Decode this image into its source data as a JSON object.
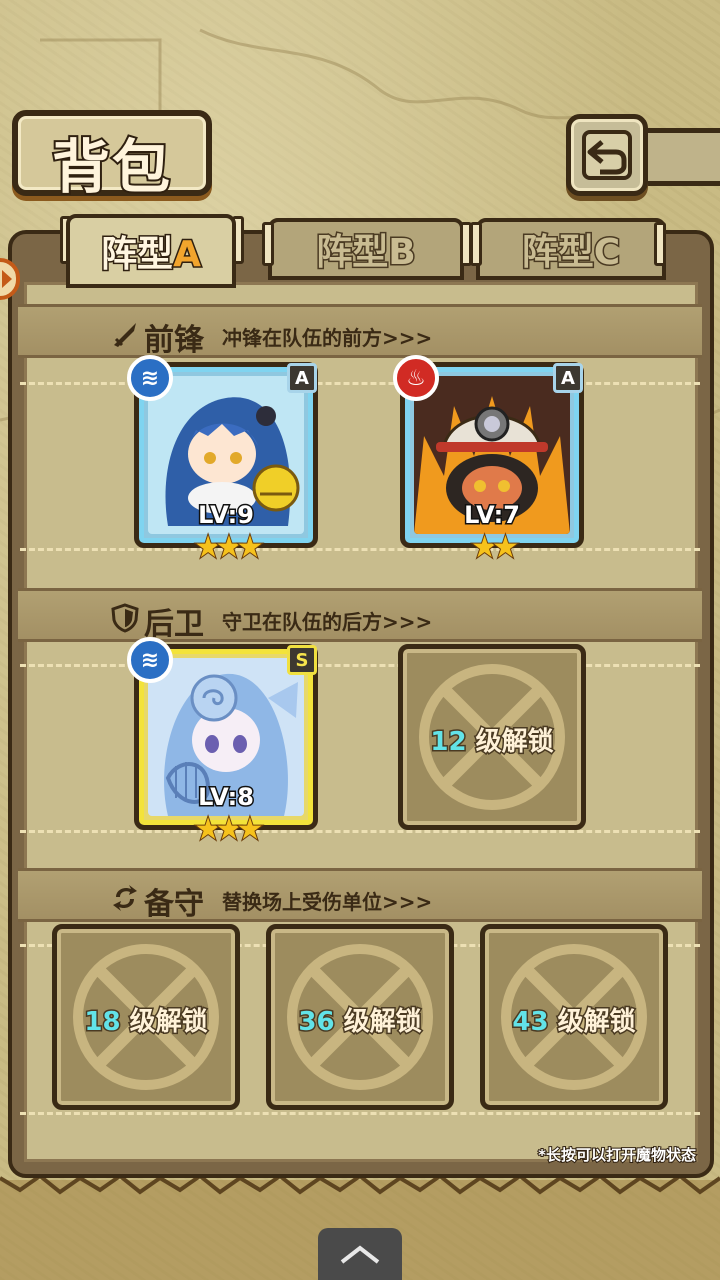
{
  "header": {
    "title": "背包",
    "back_icon": "back-arrow-icon"
  },
  "tabs": [
    {
      "prefix": "阵型",
      "suffix": "A",
      "active": true
    },
    {
      "prefix": "阵型",
      "suffix": "B",
      "active": false
    },
    {
      "prefix": "阵型",
      "suffix": "C",
      "active": false
    }
  ],
  "sections": {
    "front": {
      "title": "前锋",
      "desc": "冲锋在队伍的前方>>>",
      "icon": "sword-icon"
    },
    "rear": {
      "title": "后卫",
      "desc": "守卫在队伍的后方>>>",
      "icon": "shield-icon"
    },
    "reserve": {
      "title": "备守",
      "desc": "替换场上受伤单位>>>",
      "icon": "swap-icon"
    }
  },
  "units": [
    {
      "element": "water",
      "rank": "A",
      "level": "LV:9",
      "stars": 3
    },
    {
      "element": "fire",
      "rank": "A",
      "level": "LV:7",
      "stars": 2
    },
    {
      "element": "water",
      "rank": "S",
      "level": "LV:8",
      "stars": 3
    }
  ],
  "locked_slots": [
    {
      "level": "12",
      "text": "级解锁"
    },
    {
      "level": "18",
      "text": "级解锁"
    },
    {
      "level": "36",
      "text": "级解锁"
    },
    {
      "level": "43",
      "text": "级解锁"
    }
  ],
  "footnote": "*长按可以打开魔物状态",
  "colors": {
    "water": "#2b6fc4",
    "fire": "#d12b24",
    "unlock_level": "#62e3e8",
    "star": "#f6c21c"
  }
}
